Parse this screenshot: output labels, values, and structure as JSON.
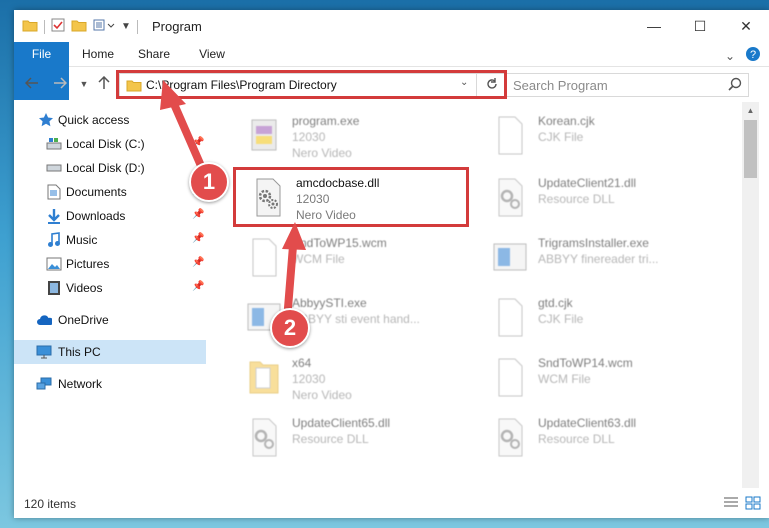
{
  "window": {
    "title": "Program",
    "controls": {
      "minimize": "—",
      "maximize": "☐",
      "close": "✕"
    }
  },
  "ribbon": {
    "tabs": [
      {
        "label": "File",
        "active": true
      },
      {
        "label": "Home"
      },
      {
        "label": "Share"
      },
      {
        "label": "View"
      }
    ]
  },
  "navigation": {
    "address_path": "C:\\Program Files\\Program Directory",
    "search_placeholder": "Search Program"
  },
  "sidebar": {
    "items": [
      {
        "label": "Quick access",
        "icon": "star-icon",
        "pinned": false
      },
      {
        "label": "Local Disk (C:)",
        "icon": "drive-icon",
        "pinned": true
      },
      {
        "label": "Local Disk (D:)",
        "icon": "drive-icon",
        "pinned": false
      },
      {
        "label": "Documents",
        "icon": "documents-icon",
        "pinned": true
      },
      {
        "label": "Downloads",
        "icon": "download-icon",
        "pinned": true
      },
      {
        "label": "Music",
        "icon": "music-icon",
        "pinned": true
      },
      {
        "label": "Pictures",
        "icon": "pictures-icon",
        "pinned": true
      },
      {
        "label": "Videos",
        "icon": "videos-icon",
        "pinned": true
      },
      {
        "label": "OneDrive",
        "icon": "cloud-icon",
        "pinned": false
      },
      {
        "label": "This PC",
        "icon": "computer-icon",
        "pinned": false,
        "selected": true
      },
      {
        "label": "Network",
        "icon": "network-icon",
        "pinned": false
      }
    ]
  },
  "files": [
    {
      "name": "program.exe",
      "line2": "12030",
      "line3": "Nero Video",
      "icon": "exe-icon",
      "blurred": true
    },
    {
      "name": "Korean.cjk",
      "line2": "CJK File",
      "line3": "",
      "icon": "blank-file-icon",
      "blurred": true
    },
    {
      "name": "amcdocbase.dll",
      "line2": "12030",
      "line3": "Nero Video",
      "icon": "dll-gear-icon",
      "blurred": false,
      "highlighted": true
    },
    {
      "name": "UpdateClient21.dll",
      "line2": "Resource DLL",
      "line3": "",
      "icon": "dll-gear-icon",
      "blurred": true
    },
    {
      "name": "SndToWP15.wcm",
      "line2": "WCM File",
      "line3": "",
      "icon": "blank-file-icon",
      "blurred": true
    },
    {
      "name": "TrigramsInstaller.exe",
      "line2": "ABBYY finereader tri...",
      "line3": "",
      "icon": "window-icon",
      "blurred": true
    },
    {
      "name": "AbbyySTI.exe",
      "line2": "ABBYY sti event hand...",
      "line3": "",
      "icon": "window-icon",
      "blurred": true
    },
    {
      "name": "gtd.cjk",
      "line2": "CJK File",
      "line3": "",
      "icon": "blank-file-icon",
      "blurred": true
    },
    {
      "name": "x64",
      "line2": "12030",
      "line3": "Nero Video",
      "icon": "folder-icon",
      "blurred": true
    },
    {
      "name": "SndToWP14.wcm",
      "line2": "WCM File",
      "line3": "",
      "icon": "blank-file-icon",
      "blurred": true
    },
    {
      "name": "UpdateClient65.dll",
      "line2": "Resource DLL",
      "line3": "",
      "icon": "dll-gear-icon",
      "blurred": true
    },
    {
      "name": "UpdateClient63.dll",
      "line2": "Resource DLL",
      "line3": "",
      "icon": "dll-gear-icon",
      "blurred": true
    }
  ],
  "status": {
    "item_count": "120 items"
  },
  "annotations": {
    "step1": "1",
    "step2": "2",
    "color": "#e24c4c"
  },
  "colors": {
    "accent": "#1979ca",
    "highlight_border": "#d33b3b",
    "selected_bg": "#cce4f7"
  }
}
